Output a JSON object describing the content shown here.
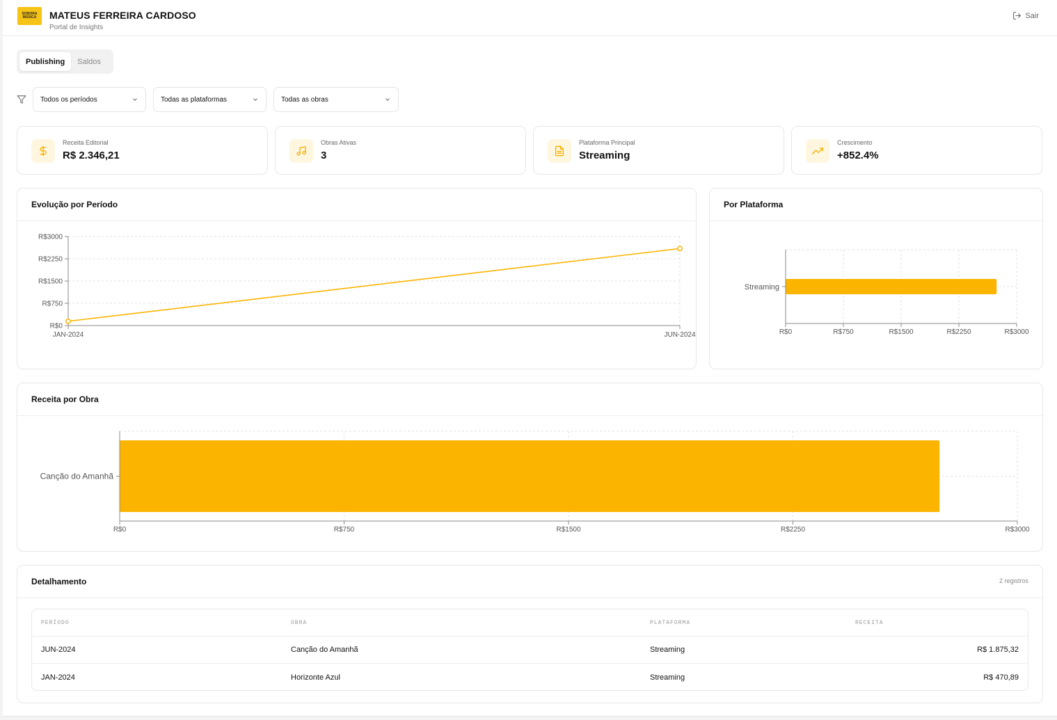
{
  "header": {
    "logo_line1": "SONORA",
    "logo_line2": "MÚSICA",
    "title": "MATEUS FERREIRA CARDOSO",
    "subtitle": "Portal de Insights",
    "logout_label": "Sair"
  },
  "tabs": [
    {
      "label": "Publishing",
      "active": true
    },
    {
      "label": "Saldos",
      "active": false
    }
  ],
  "filters": {
    "period": "Todos os períodos",
    "platform": "Todas as plataformas",
    "work": "Todas as obras"
  },
  "kpis": [
    {
      "label": "Receita Editorial",
      "value": "R$ 2.346,21",
      "icon": "dollar-icon"
    },
    {
      "label": "Obras Ativas",
      "value": "3",
      "icon": "music-note-icon"
    },
    {
      "label": "Plataforma Principal",
      "value": "Streaming",
      "icon": "document-icon"
    },
    {
      "label": "Crescimento",
      "value": "+852.4%",
      "icon": "trending-up-icon"
    }
  ],
  "accent_color": "#fbb400",
  "chart_data": [
    {
      "type": "line",
      "title": "Evolução por Período",
      "x": [
        "JAN-2024",
        "JUN-2024"
      ],
      "series": [
        {
          "values": [
            145,
            2595
          ]
        }
      ],
      "ylim": [
        0,
        3000
      ],
      "yticks": [
        0,
        750,
        1500,
        2250,
        3000
      ],
      "ytick_labels": [
        "R$0",
        "R$750",
        "R$1500",
        "R$2250",
        "R$3000"
      ],
      "grid": true,
      "color": "#fbb400"
    },
    {
      "type": "bar",
      "orientation": "horizontal",
      "title": "Por Plataforma",
      "categories": [
        "Streaming"
      ],
      "values": [
        2740
      ],
      "xlim": [
        0,
        3000
      ],
      "xticks": [
        0,
        750,
        1500,
        2250,
        3000
      ],
      "xtick_labels": [
        "R$0",
        "R$750",
        "R$1500",
        "R$2250",
        "R$3000"
      ],
      "grid": true,
      "color": "#fbb400"
    },
    {
      "type": "bar",
      "orientation": "horizontal",
      "title": "Receita por Obra",
      "categories": [
        "Canção do Amanhã"
      ],
      "values": [
        2740
      ],
      "xlim": [
        0,
        3000
      ],
      "xticks": [
        0,
        750,
        1500,
        2250,
        3000
      ],
      "xtick_labels": [
        "R$0",
        "R$750",
        "R$1500",
        "R$2250",
        "R$3000"
      ],
      "grid": true,
      "color": "#fbb400"
    }
  ],
  "detail": {
    "title": "Detalhamento",
    "count": "2 registros",
    "columns": [
      "PERÍODO",
      "OBRA",
      "PLATAFORMA",
      "RECEITA"
    ],
    "rows": [
      [
        "JUN-2024",
        "Canção do Amanhã",
        "Streaming",
        "R$ 1.875,32"
      ],
      [
        "JAN-2024",
        "Horizonte Azul",
        "Streaming",
        "R$ 470,89"
      ]
    ]
  }
}
